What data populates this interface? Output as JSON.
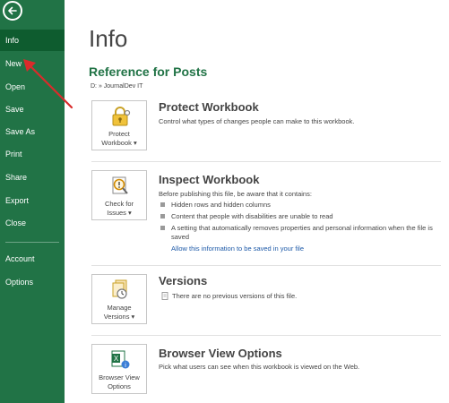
{
  "sidebar": {
    "items": [
      {
        "label": "Info",
        "active": true
      },
      {
        "label": "New"
      },
      {
        "label": "Open"
      },
      {
        "label": "Save"
      },
      {
        "label": "Save As"
      },
      {
        "label": "Print"
      },
      {
        "label": "Share"
      },
      {
        "label": "Export"
      },
      {
        "label": "Close"
      },
      {
        "label": "Account"
      },
      {
        "label": "Options"
      }
    ]
  },
  "main": {
    "page_title": "Info",
    "document_title": "Reference for Posts",
    "document_path": "D: » JournalDev IT",
    "protect": {
      "tile_label_line1": "Protect",
      "tile_label_line2": "Workbook ▾",
      "title": "Protect Workbook",
      "description": "Control what types of changes people can make to this workbook."
    },
    "inspect": {
      "tile_label_line1": "Check for",
      "tile_label_line2": "Issues ▾",
      "title": "Inspect Workbook",
      "description": "Before publishing this file, be aware that it contains:",
      "bullets": [
        "Hidden rows and hidden columns",
        "Content that people with disabilities are unable to read",
        "A setting that automatically removes properties and personal information when the file is saved"
      ],
      "link": "Allow this information to be saved in your file"
    },
    "versions": {
      "tile_label_line1": "Manage",
      "tile_label_line2": "Versions ▾",
      "title": "Versions",
      "description": "There are no previous versions of this file."
    },
    "browser_view": {
      "tile_label_line1": "Browser View",
      "tile_label_line2": "Options",
      "title": "Browser View Options",
      "description": "Pick what users can see when this workbook is viewed on the Web."
    }
  },
  "colors": {
    "sidebar_bg": "#217346",
    "sidebar_active": "#0e5c2f",
    "accent_green": "#217346",
    "link_blue": "#1e5aa8",
    "annotation_red": "#d92b2b"
  }
}
